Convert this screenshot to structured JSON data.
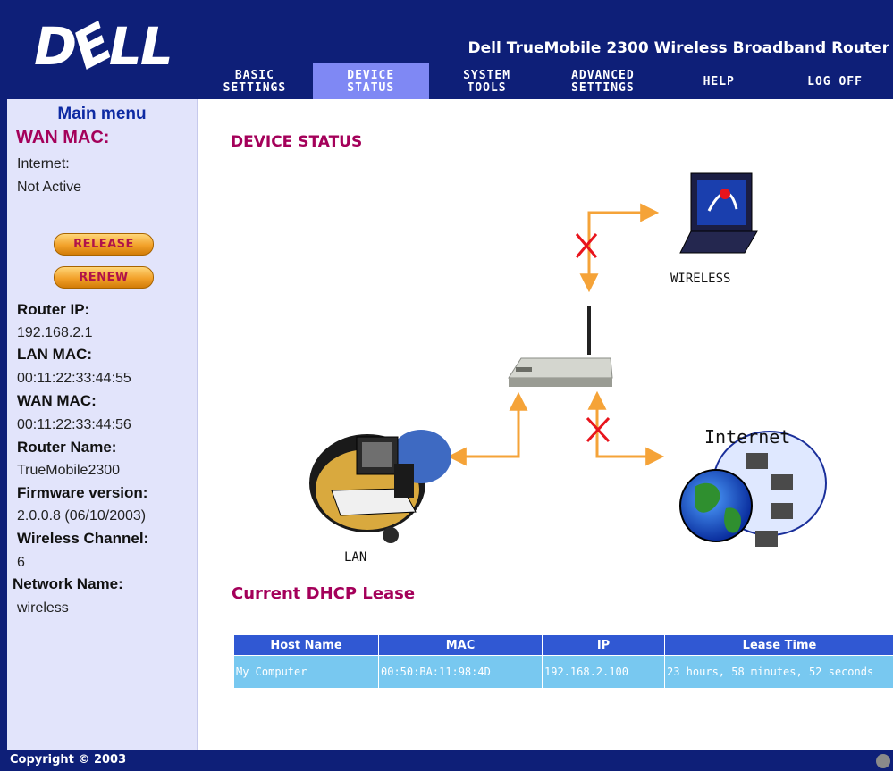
{
  "header": {
    "logo_text": "DELL",
    "title": "Dell TrueMobile 2300 Wireless Broadband Router"
  },
  "nav": [
    {
      "label": "BASIC\nSETTINGS",
      "active": false
    },
    {
      "label": "DEVICE\nSTATUS",
      "active": true
    },
    {
      "label": "SYSTEM\nTOOLS",
      "active": false
    },
    {
      "label": "ADVANCED\nSETTINGS",
      "active": false
    },
    {
      "label": "HELP",
      "active": false
    },
    {
      "label": "LOG OFF",
      "active": false
    }
  ],
  "sidebar": {
    "menu_title": "Main menu",
    "wan_mac_heading": "WAN MAC:",
    "internet_label": "Internet:",
    "internet_status": "Not Active",
    "release_button": "RELEASE",
    "renew_button": "RENEW",
    "router_ip_label": "Router IP:",
    "router_ip": "192.168.2.1",
    "lan_mac_label": "LAN MAC:",
    "lan_mac": "00:11:22:33:44:55",
    "wan_mac_label": "WAN MAC:",
    "wan_mac": "00:11:22:33:44:56",
    "router_name_label": "Router Name:",
    "router_name": "TrueMobile2300",
    "firmware_label": "Firmware version:",
    "firmware": "2.0.0.8 (06/10/2003)",
    "channel_label": "Wireless Channel:",
    "channel": "6",
    "network_name_label": "Network Name:",
    "network_name": "wireless"
  },
  "main": {
    "device_status_title": "DEVICE STATUS",
    "diagram": {
      "wireless_label": "WIRELESS",
      "internet_label": "Internet",
      "lan_label": "LAN",
      "wireless_connected": false,
      "internet_connected": false
    },
    "dhcp_title": "Current DHCP Lease",
    "dhcp_table": {
      "headers": [
        "Host Name",
        "MAC",
        "IP",
        "Lease Time"
      ],
      "rows": [
        [
          "My Computer",
          "00:50:BA:11:98:4D",
          "192.168.2.100",
          "23 hours, 58 minutes, 52 seconds"
        ]
      ]
    }
  },
  "footer": {
    "copyright": "Copyright © 2003"
  },
  "colors": {
    "navy": "#0e1f78",
    "accent_magenta": "#a4005a",
    "nav_active": "#7f88f4",
    "sidebar_bg": "#e2e4fb",
    "table_header": "#3058d3",
    "table_row": "#78c8f0",
    "arrow_orange": "#f5a338",
    "disconnect_red": "#e8141c"
  }
}
